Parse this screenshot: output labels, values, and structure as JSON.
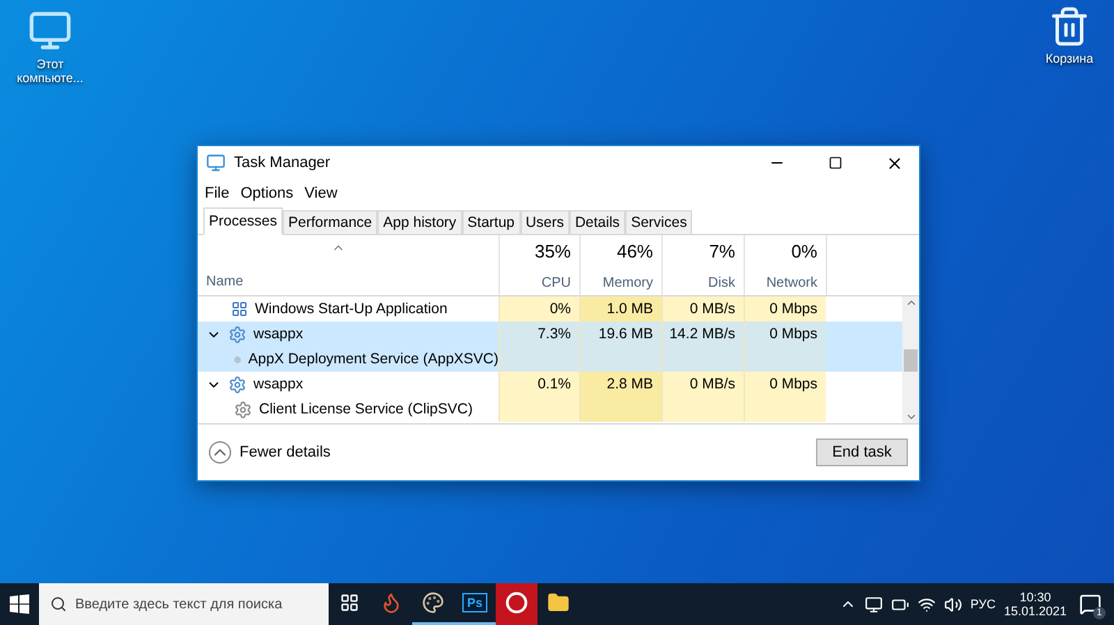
{
  "desktop_icons": [
    {
      "kind": "computer",
      "label": "Этот компьюте..."
    },
    {
      "kind": "recycle",
      "label": "Корзина"
    }
  ],
  "window": {
    "title": "Task Manager",
    "menu": [
      "File",
      "Options",
      "View"
    ],
    "tabs": [
      {
        "label": "Processes",
        "selected": true
      },
      {
        "label": "Performance",
        "selected": false
      },
      {
        "label": "App history",
        "selected": false
      },
      {
        "label": "Startup",
        "selected": false
      },
      {
        "label": "Users",
        "selected": false
      },
      {
        "label": "Details",
        "selected": false
      },
      {
        "label": "Services",
        "selected": false
      }
    ],
    "columns": [
      {
        "label": "Name"
      },
      {
        "label": "CPU",
        "total": "35%"
      },
      {
        "label": "Memory",
        "total": "46%"
      },
      {
        "label": "Disk",
        "total": "7%"
      },
      {
        "label": "Network",
        "total": "0%"
      }
    ],
    "rows": [
      {
        "kind": "app",
        "name": "Windows Start-Up Application",
        "selected": false,
        "values": [
          "0%",
          "1.0 MB",
          "0 MB/s",
          "0 Mbps"
        ]
      },
      {
        "kind": "host",
        "name": "wsappx",
        "expanded": true,
        "selected": true,
        "values": [
          "7.3%",
          "19.6 MB",
          "14.2 MB/s",
          "0 Mbps"
        ],
        "children": [
          {
            "name": "AppX Deployment Service (AppXSVC)"
          }
        ]
      },
      {
        "kind": "host",
        "name": "wsappx",
        "expanded": true,
        "selected": false,
        "values": [
          "0.1%",
          "2.8 MB",
          "0 MB/s",
          "0 Mbps"
        ],
        "children": [
          {
            "name": "Client License Service (ClipSVC)"
          }
        ]
      }
    ],
    "footer": {
      "toggle": "Fewer details",
      "button": "End task"
    }
  },
  "taskbar": {
    "search_placeholder": "Введите здесь текст для поиска",
    "apps": [
      {
        "kind": "game",
        "running": false
      },
      {
        "kind": "paint",
        "running": true
      },
      {
        "kind": "photoshop",
        "label": "Ps",
        "running": true
      },
      {
        "kind": "browser",
        "running": false
      },
      {
        "kind": "folder",
        "running": false
      }
    ],
    "language": "РУС",
    "time": "10:30",
    "date": "15.01.2021",
    "notification_count": "1"
  }
}
